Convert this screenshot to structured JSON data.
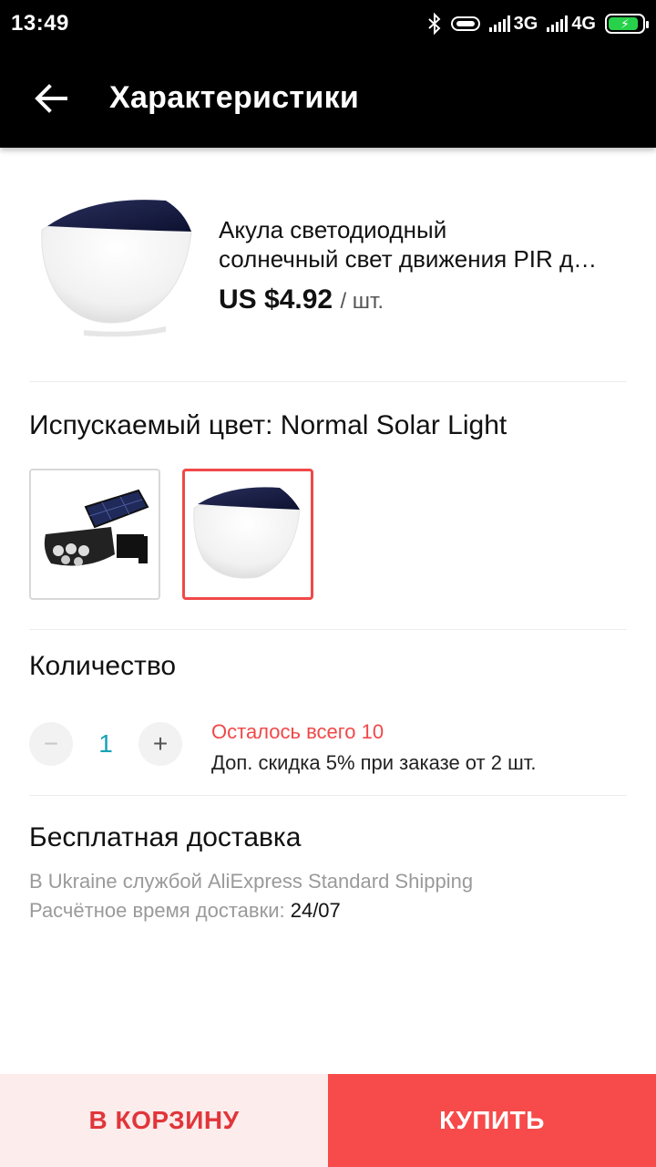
{
  "status_bar": {
    "time": "13:49",
    "network_1": "3G",
    "network_2": "4G",
    "icons": [
      "bluetooth-icon",
      "vibrate-icon",
      "signal-icon",
      "signal-icon",
      "battery-charging-icon"
    ]
  },
  "header": {
    "back_icon": "arrow-left-icon",
    "title": "Характеристики"
  },
  "product": {
    "name_line1": "Акула светодиодный",
    "name_line2": "солнечный свет движения PIR д…",
    "price": "US $4.92",
    "unit": "/ шт."
  },
  "color_option": {
    "label": "Испускаемый цвет: Normal Solar Light",
    "swatches": [
      "Flood solar light with panel",
      "Normal Solar Light"
    ],
    "selected_index": 1
  },
  "quantity": {
    "label": "Количество",
    "minus_symbol": "−",
    "value": "1",
    "plus_symbol": "+",
    "stock_note": "Осталось всего 10",
    "discount_note": "Доп. скидка 5% при заказе от 2 шт."
  },
  "shipping": {
    "title": "Бесплатная доставка",
    "method_line": "В Ukraine службой AliExpress Standard Shipping",
    "eta_label": "Расчётное время доставки: ",
    "eta_value": "24/07"
  },
  "actions": {
    "add_to_cart": "В КОРЗИНУ",
    "buy_now": "КУПИТЬ"
  },
  "colors": {
    "accent": "#f74a4a",
    "accent_light": "#fdecec",
    "qty_blue": "#17a2b8"
  }
}
